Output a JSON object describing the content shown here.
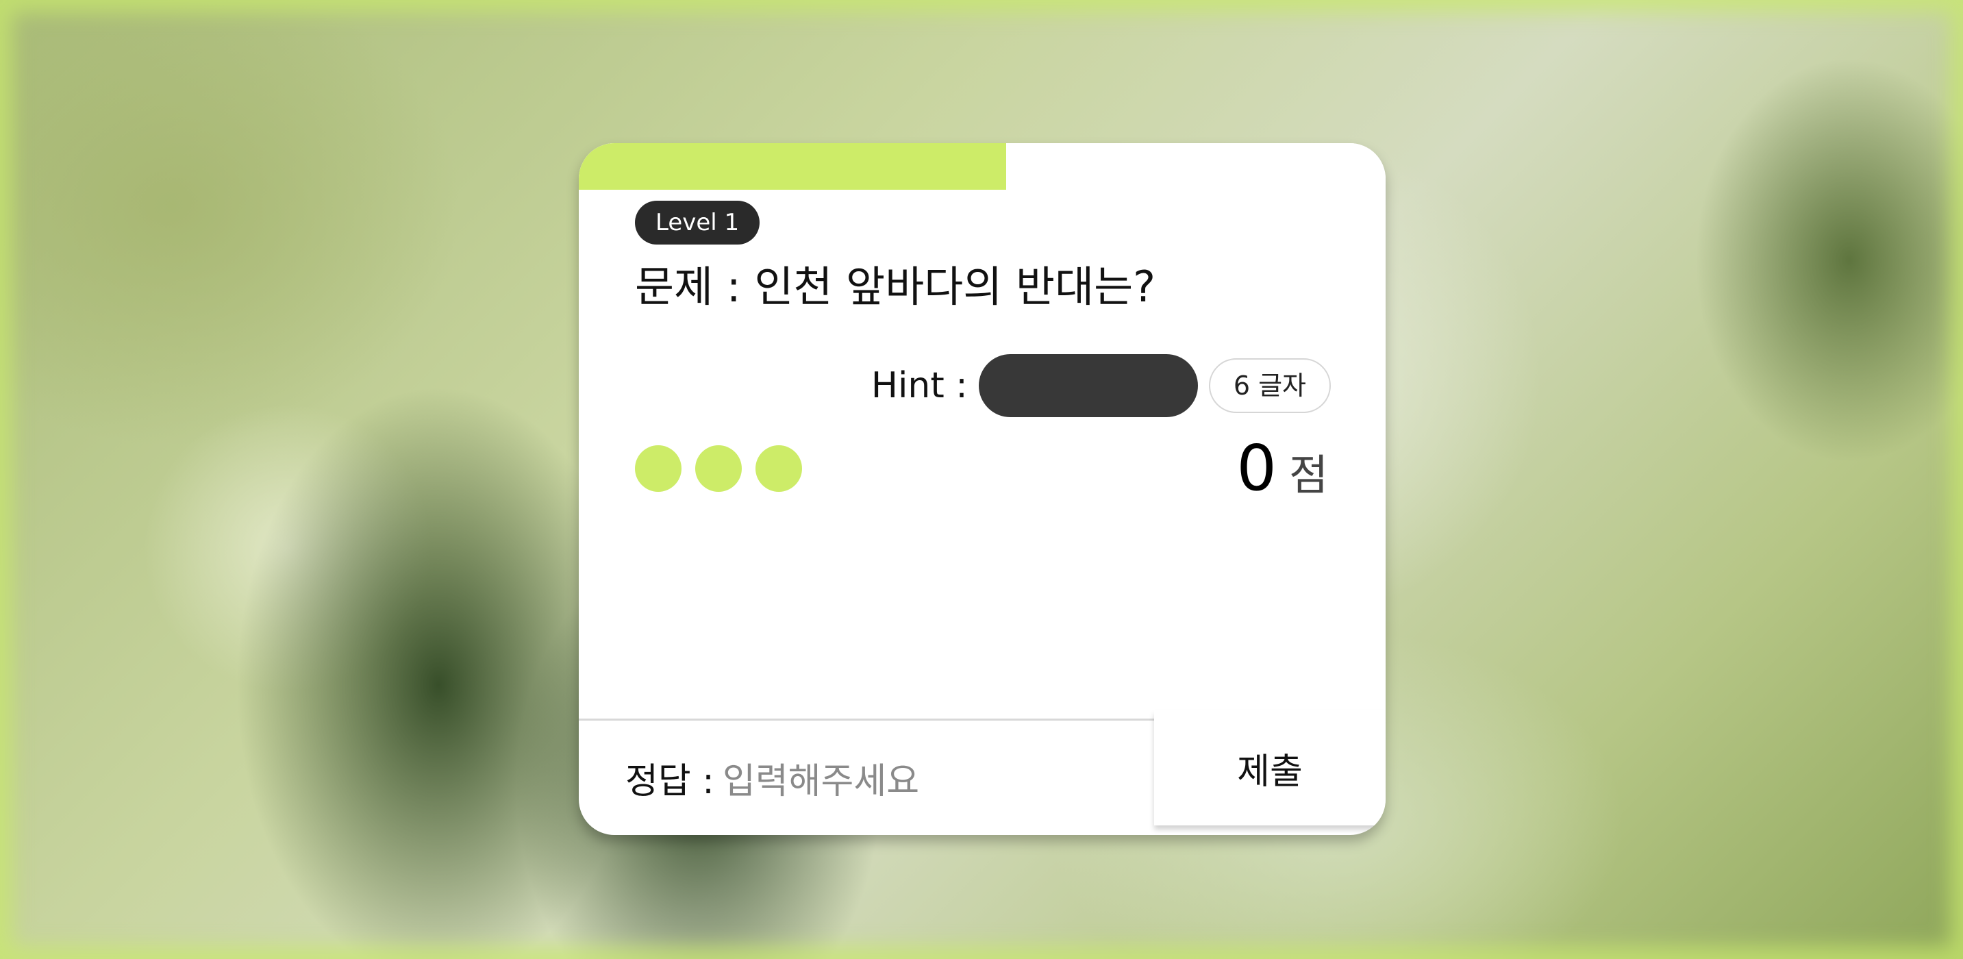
{
  "colors": {
    "accent": "#cdec68",
    "badge_bg": "#2a2a2a",
    "hint_mask": "#383838"
  },
  "progress": {
    "fraction": 0.53
  },
  "quiz": {
    "level": "Level 1",
    "question": "문제 : 인천 앞바다의 반대는?",
    "hint_label": "Hint :",
    "hint_length": "6 글자"
  },
  "lives": {
    "remaining": 3
  },
  "score": {
    "value": "0",
    "unit": "점"
  },
  "answer": {
    "label": "정답 :",
    "placeholder": "입력해주세요",
    "value": ""
  },
  "submit": {
    "label": "제출"
  }
}
